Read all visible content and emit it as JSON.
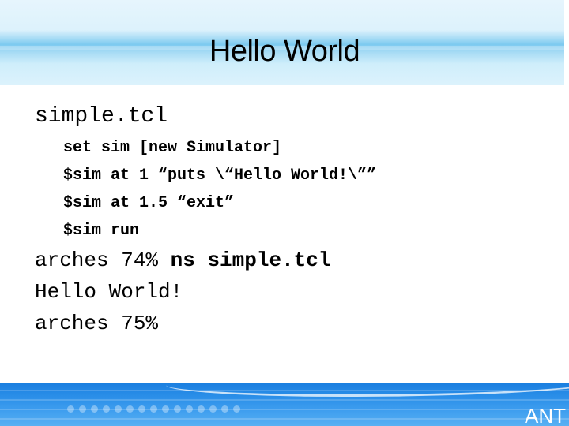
{
  "slide": {
    "title": "Hello World",
    "file_label": "simple.tcl",
    "code_lines": [
      "set sim [new Simulator]",
      "$sim at 1 “puts \\“Hello World!\\””",
      "$sim at 1.5 “exit”",
      "$sim run"
    ],
    "output": {
      "prompt1": "arches 74% ",
      "command": "ns simple.tcl",
      "result": "Hello World!",
      "prompt2": "arches 75%"
    },
    "footer_logo": "ANT"
  },
  "colors": {
    "header_band": "#7dcaf0",
    "footer": "#2a8ee8"
  }
}
